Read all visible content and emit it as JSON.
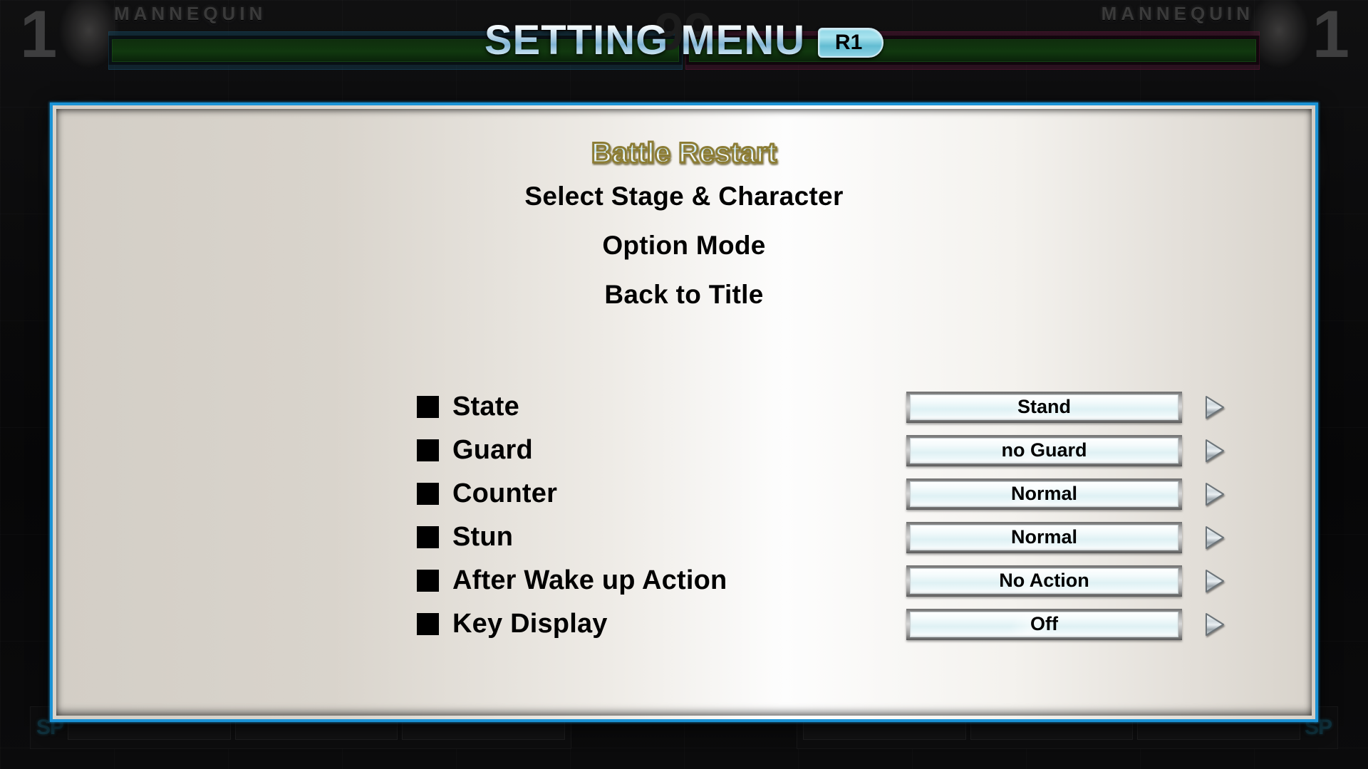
{
  "header": {
    "title": "SETTING MENU",
    "button_hint": "R1"
  },
  "background": {
    "player_left": {
      "round": "1",
      "name": "MANNEQUIN",
      "sp_label": "SP"
    },
    "player_right": {
      "round": "1",
      "name": "MANNEQUIN",
      "sp_label": "SP"
    },
    "timer": "99"
  },
  "menu": {
    "items": [
      {
        "label": "Battle Restart",
        "selected": true
      },
      {
        "label": "Select Stage & Character",
        "selected": false
      },
      {
        "label": "Option Mode",
        "selected": false
      },
      {
        "label": "Back to Title",
        "selected": false
      }
    ]
  },
  "settings": {
    "rows": [
      {
        "label": "State",
        "value": "Stand"
      },
      {
        "label": "Guard",
        "value": "no Guard"
      },
      {
        "label": "Counter",
        "value": "Normal"
      },
      {
        "label": "Stun",
        "value": "Normal"
      },
      {
        "label": "After Wake up Action",
        "value": "No Action"
      },
      {
        "label": "Key Display",
        "value": "Off"
      }
    ]
  },
  "colors": {
    "panel_border": "#1b93d6",
    "badge_fill": "#8fd6e6",
    "selected_outline": "#8c7c34",
    "panel_bg": "#d6d1c9"
  }
}
